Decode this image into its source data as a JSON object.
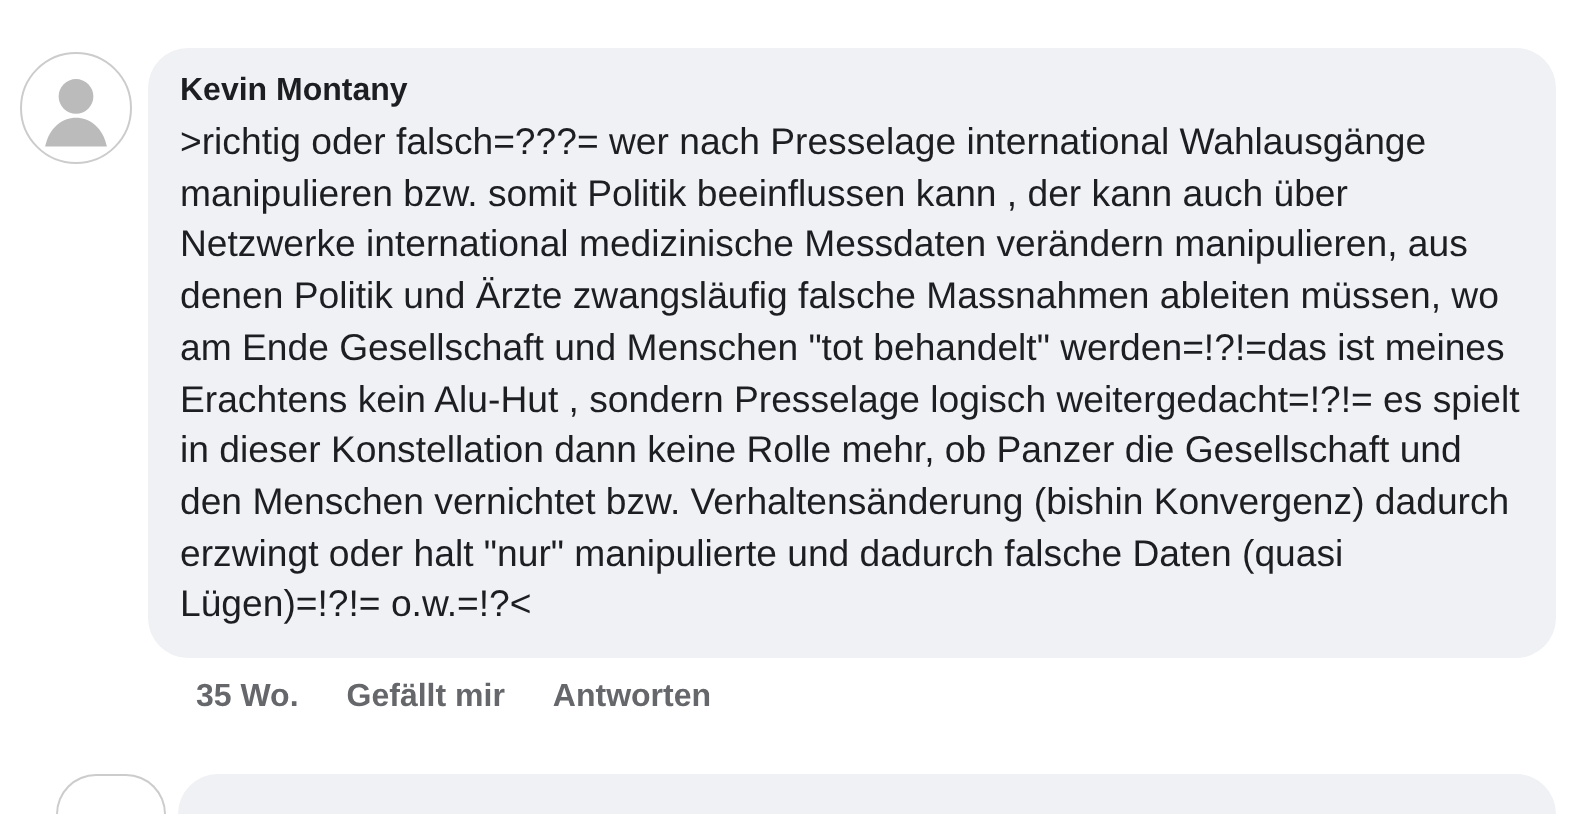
{
  "comment": {
    "author": "Kevin Montany",
    "text": ">richtig oder falsch=???= wer nach Presselage international Wahlausgänge manipulieren bzw. somit Politik beeinflussen kann , der kann auch über Netzwerke international medizinische Messdaten verändern manipulieren, aus denen Politik und Ärzte zwangsläufig falsche Massnahmen ableiten müssen, wo am Ende Gesellschaft und Menschen \"tot behandelt\" werden=!?!=das ist meines Erachtens kein Alu-Hut , sondern Presselage logisch weitergedacht=!?!= es spielt in dieser Konstellation dann keine Rolle mehr, ob Panzer die Gesellschaft und den Menschen vernichtet bzw. Verhaltensänderung (bishin Konvergenz) dadurch erzwingt oder halt \"nur\" manipulierte und dadurch falsche Daten (quasi Lügen)=!?!= o.w.=!?<",
    "time": "35 Wo.",
    "actions": [
      "Gefällt mir",
      "Antworten"
    ]
  }
}
